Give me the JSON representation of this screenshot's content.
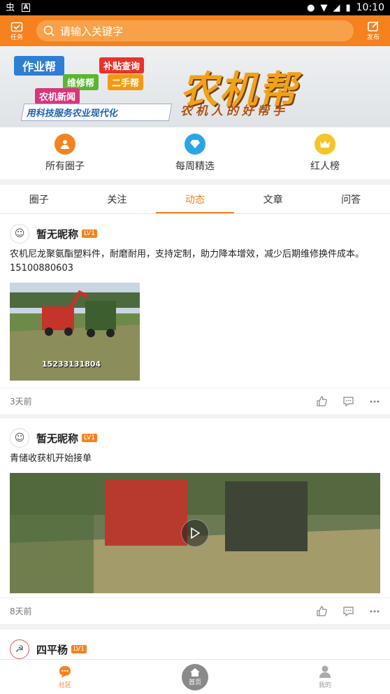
{
  "status": {
    "time": "10:10"
  },
  "header": {
    "task_label": "任务",
    "search_placeholder": "请输入关键字",
    "publish_label": "发布"
  },
  "banner": {
    "tags": [
      "作业帮",
      "补贴查询",
      "维修帮",
      "二手帮",
      "农机新闻"
    ],
    "slogan": "用科技服务农业现代化",
    "title": "农机帮",
    "motto": "农机人的好帮手"
  },
  "quick": [
    {
      "label": "所有圈子",
      "color": "#f5821f",
      "icon": "people-icon"
    },
    {
      "label": "每周精选",
      "color": "#2ba5e8",
      "icon": "diamond-icon"
    },
    {
      "label": "红人榜",
      "color": "#f5c528",
      "icon": "crown-icon"
    }
  ],
  "tabs": [
    "圈子",
    "关注",
    "动态",
    "文章",
    "问答"
  ],
  "active_tab": "动态",
  "posts": [
    {
      "user": "暂无昵称",
      "level": "LV1",
      "text": "农机尼龙聚氨酯塑料件，耐磨耐用，支持定制，助力降本增效，减少后期维修换件成本。15100880603",
      "image_caption": "15233131804",
      "time": "3天前"
    },
    {
      "user": "暂无昵称",
      "level": "LV1",
      "text": "青储收获机开始接单",
      "time": "8天前"
    },
    {
      "user": "四平杨",
      "level": "LV1"
    }
  ],
  "nav": [
    {
      "label": "社区",
      "icon": "chat-icon"
    },
    {
      "label": "首页",
      "icon": "home-icon"
    },
    {
      "label": "我的",
      "icon": "user-icon"
    }
  ]
}
